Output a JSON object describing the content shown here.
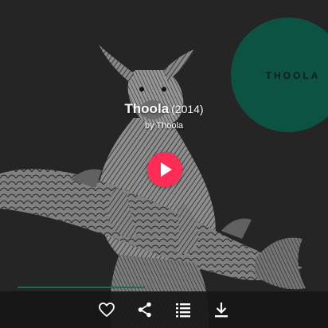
{
  "album": {
    "title": "Thoola",
    "year": "(2014)",
    "artist_line": "by Thoola"
  },
  "artwork": {
    "badge_text": "THOOLA",
    "badge_color": "#0b6b55"
  },
  "player": {
    "accent_color": "#ff2d55",
    "play_icon": "play-icon"
  },
  "toolbar": {
    "icons": [
      "heart-icon",
      "share-icon",
      "add-to-queue-icon",
      "download-icon"
    ]
  }
}
